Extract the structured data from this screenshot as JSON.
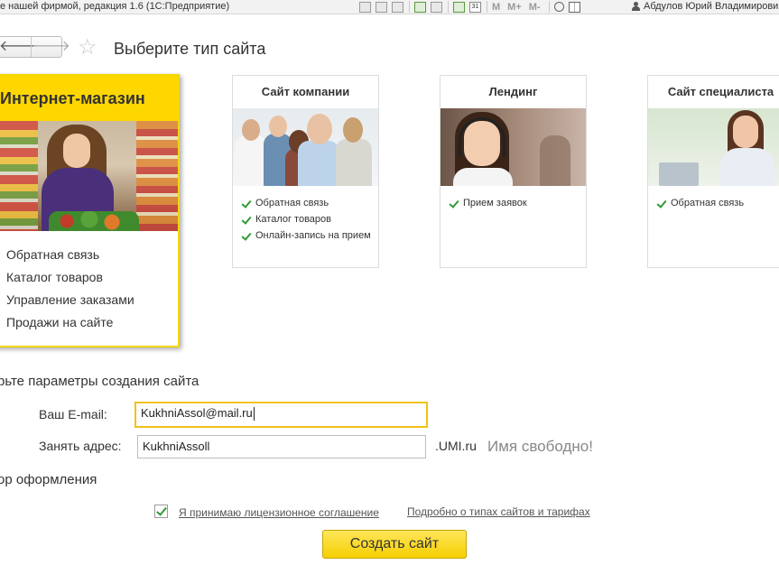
{
  "window": {
    "title": "е нашей фирмой, редакция 1.6 (1С:Предприятие)",
    "toolbar_labels": {
      "m": "M",
      "m_plus": "M+",
      "m_minus": "M-",
      "calendar_day": "31"
    },
    "user": "Абдулов Юрий Владимирович"
  },
  "nav": {
    "back_glyph": "🡐",
    "forward_glyph": "🡒",
    "star_glyph": "☆"
  },
  "page": {
    "title": "Выберите тип сайта"
  },
  "cards": [
    {
      "title": "Интернет-магазин",
      "selected": true,
      "features": [
        "Обратная связь",
        "Каталог товаров",
        "Управление заказами",
        "Продажи на сайте"
      ]
    },
    {
      "title": "Сайт компании",
      "selected": false,
      "features": [
        "Обратная связь",
        "Каталог товаров",
        "Онлайн-запись на прием"
      ]
    },
    {
      "title": "Лендинг",
      "selected": false,
      "features": [
        "Прием заявок"
      ]
    },
    {
      "title": "Сайт специалиста",
      "selected": false,
      "features": [
        "Обратная связь"
      ]
    }
  ],
  "form": {
    "params_heading": "рьте параметры создания сайта",
    "email_label": "Ваш E-mail:",
    "email_value": "KukhniAssol@mail.ru",
    "address_label": "Занять адрес:",
    "address_value": "KukhniAssoll",
    "address_suffix": ".UMI.ru",
    "availability": "Имя свободно!",
    "design_heading": "ор оформления"
  },
  "agreement": {
    "checked": true,
    "license_link": "Я принимаю лицензионное  соглашение",
    "details_link": "Подробно о типах сайтов и тарифах"
  },
  "actions": {
    "create_label": "Создать сайт"
  },
  "colors": {
    "accent_yellow": "#ffd700",
    "focus_border": "#f1c21b",
    "check_green": "#2f9a34"
  }
}
